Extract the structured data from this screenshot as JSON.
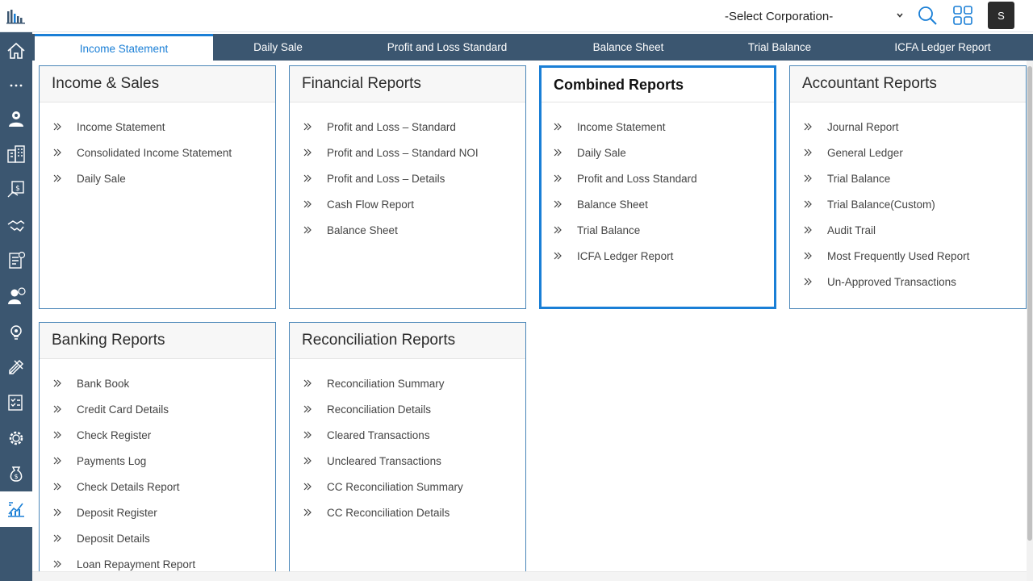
{
  "topbar": {
    "corporation_select": "-Select Corporation-",
    "avatar_initial": "S"
  },
  "sidebar": {
    "icons": [
      "home-icon",
      "more-icon",
      "people-settings-icon",
      "building-icon",
      "money-hand-icon",
      "handshake-icon",
      "invoice-icon",
      "person-dollar-icon",
      "lightbulb-gear-icon",
      "tools-icon",
      "checklist-icon",
      "gear-dollar-icon",
      "money-bag-icon",
      "reports-chart-icon"
    ]
  },
  "tabs": [
    {
      "label": "Income Statement"
    },
    {
      "label": "Daily Sale"
    },
    {
      "label": "Profit and Loss Standard"
    },
    {
      "label": "Balance Sheet"
    },
    {
      "label": "Trial Balance"
    },
    {
      "label": "ICFA Ledger Report"
    }
  ],
  "cards": {
    "income_sales": {
      "title": "Income & Sales",
      "items": [
        "Income Statement",
        "Consolidated Income Statement",
        "Daily Sale"
      ]
    },
    "financial": {
      "title": "Financial Reports",
      "items": [
        "Profit and Loss – Standard",
        "Profit and Loss – Standard NOI",
        "Profit and Loss – Details",
        "Cash Flow Report",
        "Balance Sheet"
      ]
    },
    "combined": {
      "title": "Combined Reports",
      "items": [
        "Income Statement",
        "Daily Sale",
        "Profit and Loss Standard",
        "Balance Sheet",
        "Trial Balance",
        "ICFA Ledger Report"
      ]
    },
    "accountant": {
      "title": "Accountant Reports",
      "items": [
        "Journal Report",
        "General Ledger",
        "Trial Balance",
        "Trial Balance(Custom)",
        "Audit Trail",
        "Most Frequently Used Report",
        "Un-Approved Transactions"
      ]
    },
    "banking": {
      "title": "Banking Reports",
      "items": [
        "Bank Book",
        "Credit Card Details",
        "Check Register",
        "Payments Log",
        "Check Details Report",
        "Deposit Register",
        "Deposit Details",
        "Loan Repayment Report"
      ]
    },
    "reconciliation": {
      "title": "Reconciliation Reports",
      "items": [
        "Reconciliation Summary",
        "Reconciliation Details",
        "Cleared Transactions",
        "Uncleared Transactions",
        "CC Reconciliation Summary",
        "CC Reconciliation Details"
      ]
    }
  },
  "colors": {
    "sidebar": "#3b5670",
    "accent": "#1a7fd6",
    "card_border": "#4a86b8"
  }
}
